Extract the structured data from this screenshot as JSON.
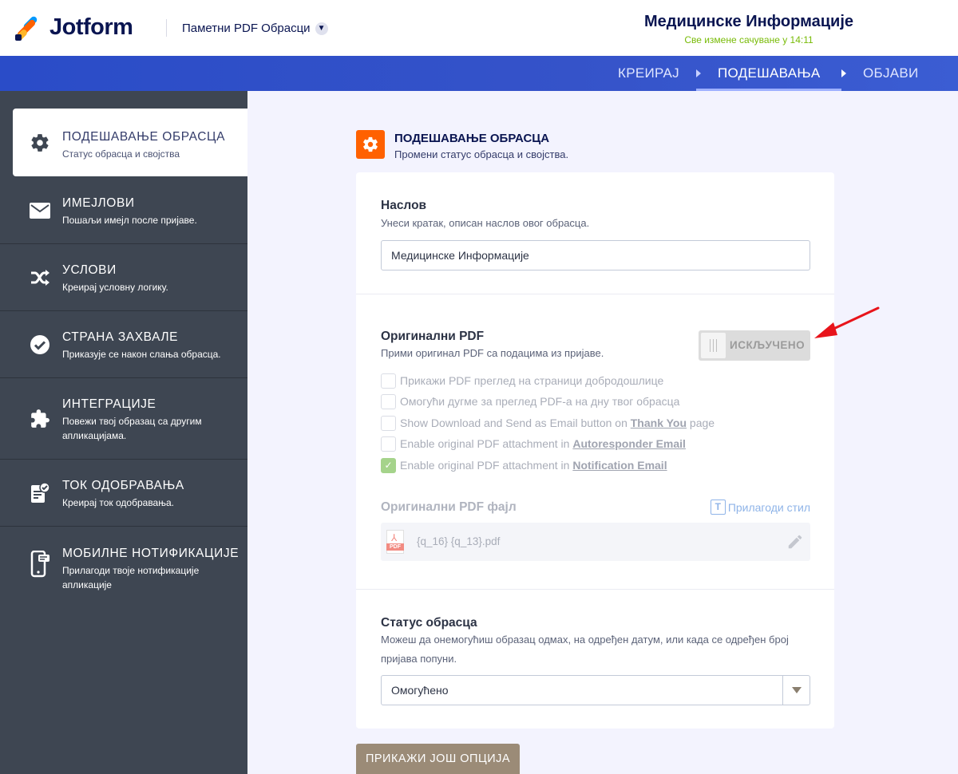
{
  "header": {
    "brand": "Jotform",
    "product": "Паметни PDF Обрасци",
    "form_title": "Медицинске Информације",
    "saved_status": "Све измене сачуване у 14:11"
  },
  "nav": {
    "items": [
      {
        "label": "КРЕИРАЈ",
        "active": false
      },
      {
        "label": "ПОДЕШАВАЊА",
        "active": true
      },
      {
        "label": "ОБЈАВИ",
        "active": false
      }
    ]
  },
  "sidebar": {
    "items": [
      {
        "title": "ПОДЕШАВАЊЕ ОБРАСЦА",
        "subtitle": "Статус обрасца и својства",
        "icon": "gear-icon",
        "active": true
      },
      {
        "title": "ИМЕЈЛОВИ",
        "subtitle": "Пошаљи имејл после пријаве.",
        "icon": "envelope-icon",
        "active": false
      },
      {
        "title": "УСЛОВИ",
        "subtitle": "Креирај условну логику.",
        "icon": "shuffle-icon",
        "active": false
      },
      {
        "title": "СТРАНА ЗАХВАЛЕ",
        "subtitle": "Приказује се након слања обрасца.",
        "icon": "check-circle-icon",
        "active": false
      },
      {
        "title": "ИНТЕГРАЦИЈЕ",
        "subtitle": "Повежи твој образац са другим апликацијама.",
        "icon": "puzzle-icon",
        "active": false
      },
      {
        "title": "ТОК ОДОБРАВАЊА",
        "subtitle": "Креирај ток одобравања.",
        "icon": "approval-flow-icon",
        "active": false
      },
      {
        "title": "МОБИЛНЕ НОТИФИКАЦИЈЕ",
        "subtitle": "Прилагоди твоје нотификације апликације",
        "icon": "mobile-notification-icon",
        "active": false
      }
    ]
  },
  "section": {
    "title": "ПОДЕШАВАЊЕ ОБРАСЦА",
    "subtitle": "Промени статус обрасца и својства."
  },
  "title_field": {
    "label": "Наслов",
    "description": "Унеси кратак, описан наслов овог обрасца.",
    "value": "Медицинске Информације"
  },
  "original_pdf": {
    "label": "Оригинални PDF",
    "description": "Прими оригинал PDF са подацима из пријаве.",
    "toggle_label": "ИСКЉУЧЕНО",
    "toggle_on": false,
    "options": [
      {
        "text": "Прикажи PDF преглед на страници добродошлице",
        "link": "",
        "after": "",
        "checked": false
      },
      {
        "text": "Омогући дугме за преглед PDF-а на дну твог обрасца",
        "link": "",
        "after": "",
        "checked": false
      },
      {
        "text": "Show Download and Send as Email button on ",
        "link": "Thank You",
        "after": " page",
        "checked": false
      },
      {
        "text": "Enable original PDF attachment in ",
        "link": "Autoresponder Email",
        "after": "",
        "checked": false
      },
      {
        "text": "Enable original PDF attachment in ",
        "link": "Notification Email",
        "after": "",
        "checked": true
      }
    ],
    "file_label": "Оригинални PDF фајл",
    "customize_style": "Прилагоди стил",
    "file_name": "{q_16} {q_13}.pdf",
    "pdf_tag": "PDF"
  },
  "form_status": {
    "label": "Статус обрасца",
    "description": "Можеш да онемогућиш образац одмах, на одређен датум, или када се одређен број пријава попуни.",
    "selected": "Омогућено"
  },
  "more_options": "ПРИКАЖИ ЈОШ ОПЦИЈА",
  "colors": {
    "accent_orange": "#ff6100",
    "nav_blue": "#2a4cc8",
    "sidebar_bg": "#3e4652",
    "saved_green": "#78bb07",
    "arrow_red": "#e8141b"
  }
}
